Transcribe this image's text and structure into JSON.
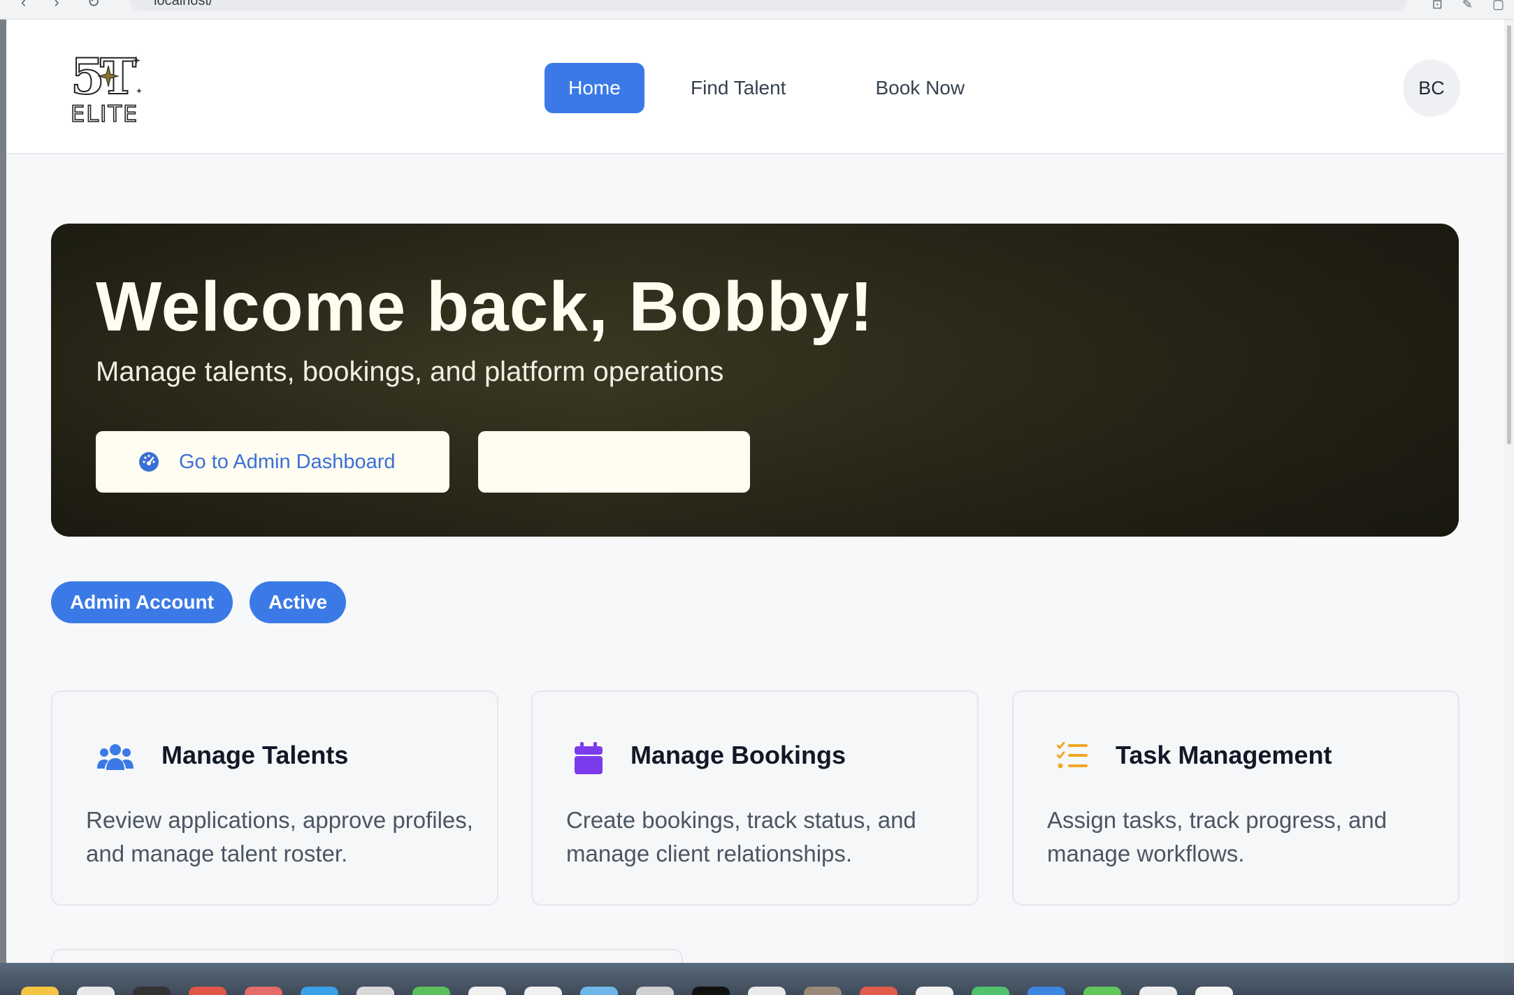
{
  "browser": {
    "url": "localhost/"
  },
  "header": {
    "logo_alt": "5T ELITE",
    "nav": {
      "home": "Home",
      "find_talent": "Find Talent",
      "book_now": "Book Now"
    },
    "avatar_initials": "BC"
  },
  "hero": {
    "title": "Welcome back, Bobby!",
    "subtitle": "Manage talents, bookings, and platform operations",
    "primary_button": "Go to Admin Dashboard",
    "secondary_button": ""
  },
  "badges": {
    "account": "Admin Account",
    "status": "Active"
  },
  "cards": [
    {
      "title": "Manage Talents",
      "description": "Review applications, approve profiles, and manage talent roster.",
      "icon": "users-icon",
      "icon_color": "#3b7ae6"
    },
    {
      "title": "Manage Bookings",
      "description": "Create bookings, track status, and manage client relationships.",
      "icon": "calendar-icon",
      "icon_color": "#7c3aed"
    },
    {
      "title": "Task Management",
      "description": "Assign tasks, track progress, and manage workflows.",
      "icon": "task-list-icon",
      "icon_color": "#f0a623"
    }
  ],
  "colors": {
    "accent": "#3b7ae6",
    "hero_bg": "#2c2a1a",
    "hero_text": "#fffdf0",
    "button_text": "#3b6fd8"
  }
}
